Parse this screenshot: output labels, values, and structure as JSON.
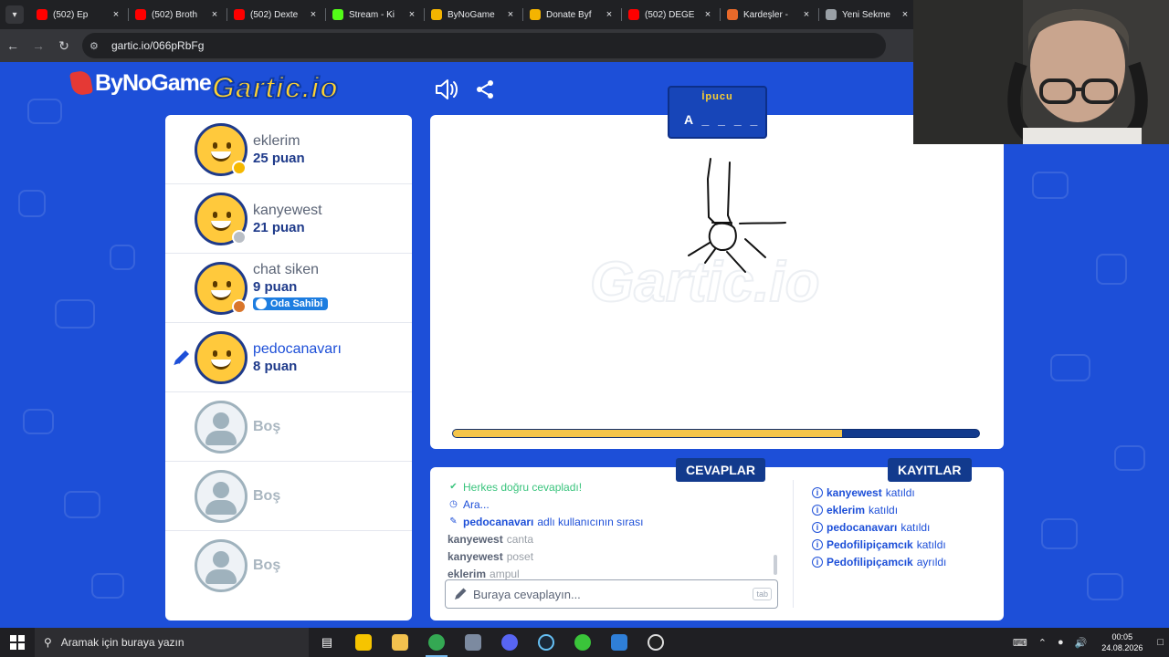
{
  "browser": {
    "tabs": [
      {
        "label": "(502) Ep",
        "color": "#ff0000"
      },
      {
        "label": "(502) Broth",
        "color": "#ff0000"
      },
      {
        "label": "(502) Dexte",
        "color": "#ff0000"
      },
      {
        "label": "Stream - Ki",
        "color": "#53fc18"
      },
      {
        "label": "ByNoGame",
        "color": "#f4b400"
      },
      {
        "label": "Donate Byf",
        "color": "#f4b400"
      },
      {
        "label": "(502) DEĞE",
        "color": "#ff0000"
      },
      {
        "label": "Kardeşler -",
        "color": "#e8692a"
      },
      {
        "label": "Yeni Sekme",
        "color": "#9aa0a6"
      }
    ],
    "url": "gartic.io/066pRbFg"
  },
  "game": {
    "logo_bynogame": "ByNoGame",
    "logo_gartic": "Gartic.io",
    "hint": {
      "label": "İpucu",
      "word": "A _ _ _ _ _"
    },
    "watermark": "Gartic.io",
    "progress": 0.74,
    "players": [
      {
        "name": "eklerim",
        "score": "25 puan",
        "rank_color": "#f5b800"
      },
      {
        "name": "kanyewest",
        "score": "21 puan",
        "rank_color": "#b9bec5"
      },
      {
        "name": "chat siken",
        "score": "9 puan",
        "rank_color": "#d9762b",
        "badge": "Oda Sahibi"
      },
      {
        "name": "pedocanavarı",
        "score": "8 puan",
        "drawing": true
      }
    ],
    "empty_slot_label": "Boş",
    "answers_tab": "CEVAPLAR",
    "logs_tab": "KAYITLAR",
    "chat": [
      {
        "type": "system-ok",
        "text": "Herkes doğru cevapladı!"
      },
      {
        "type": "system",
        "text": "Ara..."
      },
      {
        "type": "turn",
        "user": "pedocanavarı",
        "text": "adlı kullanıcının sırası"
      },
      {
        "type": "guess",
        "user": "kanyewest",
        "text": "canta"
      },
      {
        "type": "guess",
        "user": "kanyewest",
        "text": "poset"
      },
      {
        "type": "guess",
        "user": "eklerim",
        "text": "ampul"
      }
    ],
    "answer_placeholder": "Buraya cevaplayın...",
    "tab_key": "tab",
    "logs": [
      {
        "user": "kanyewest",
        "action": "katıldı"
      },
      {
        "user": "eklerim",
        "action": "katıldı"
      },
      {
        "user": "pedocanavarı",
        "action": "katıldı"
      },
      {
        "user": "Pedofilipiçamcık",
        "action": "katıldı"
      },
      {
        "user": "Pedofilipiçamcık",
        "action": "ayrıldı"
      }
    ]
  },
  "taskbar": {
    "search_placeholder": "Aramak için buraya yazın",
    "time": "00:05",
    "date": "24.08.2026"
  }
}
